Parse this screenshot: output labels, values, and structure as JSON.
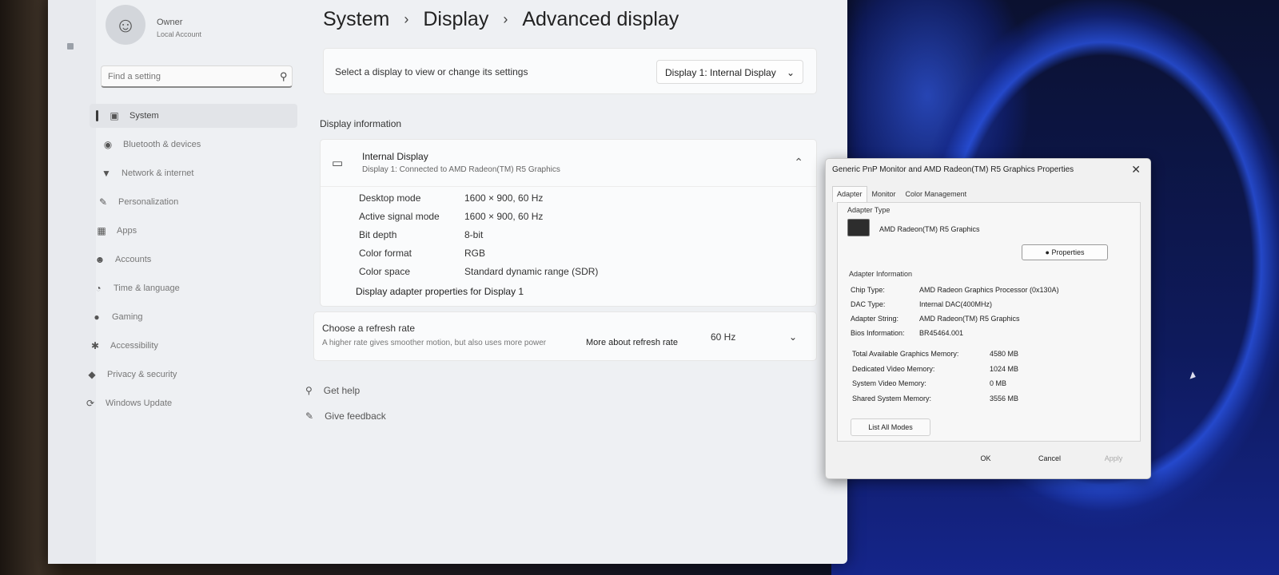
{
  "account": {
    "name": "Owner",
    "type": "Local Account"
  },
  "search": {
    "placeholder": "Find a setting"
  },
  "sidebar": {
    "items": [
      {
        "label": "System",
        "icon": "display-icon"
      },
      {
        "label": "Bluetooth & devices",
        "icon": "bluetooth-icon"
      },
      {
        "label": "Network & internet",
        "icon": "wifi-icon"
      },
      {
        "label": "Personalization",
        "icon": "brush-icon"
      },
      {
        "label": "Apps",
        "icon": "apps-icon"
      },
      {
        "label": "Accounts",
        "icon": "person-icon"
      },
      {
        "label": "Time & language",
        "icon": "globe-clock-icon"
      },
      {
        "label": "Gaming",
        "icon": "gamepad-icon"
      },
      {
        "label": "Accessibility",
        "icon": "accessibility-icon"
      },
      {
        "label": "Privacy & security",
        "icon": "shield-icon"
      },
      {
        "label": "Windows Update",
        "icon": "update-icon"
      }
    ]
  },
  "breadcrumb": {
    "part1": "System",
    "part2": "Display",
    "part3": "Advanced display"
  },
  "select_display": {
    "text": "Select a display to view or change its settings",
    "value": "Display 1: Internal Display"
  },
  "display_info": {
    "section_title": "Display information",
    "title": "Internal Display",
    "subtitle": "Display 1: Connected to AMD Radeon(TM) R5 Graphics",
    "rows": [
      {
        "key": "Desktop mode",
        "value": "1600 × 900, 60 Hz"
      },
      {
        "key": "Active signal mode",
        "value": "1600 × 900, 60 Hz"
      },
      {
        "key": "Bit depth",
        "value": "8-bit"
      },
      {
        "key": "Color format",
        "value": "RGB"
      },
      {
        "key": "Color space",
        "value": "Standard dynamic range (SDR)"
      }
    ],
    "adapter_link": "Display adapter properties for Display 1"
  },
  "refresh": {
    "title": "Choose a refresh rate",
    "subtitle": "A higher rate gives smoother motion, but also uses more power",
    "link": "More about refresh rate",
    "value": "60 Hz"
  },
  "help": {
    "get_help": "Get help",
    "feedback": "Give feedback"
  },
  "dialog": {
    "title": "Generic PnP Monitor and AMD Radeon(TM) R5 Graphics Properties",
    "tabs": [
      "Adapter",
      "Monitor",
      "Color Management"
    ],
    "adapter_type_label": "Adapter Type",
    "adapter_name": "AMD Radeon(TM) R5 Graphics",
    "properties_button": "Properties",
    "adapter_info_label": "Adapter Information",
    "info": [
      {
        "key": "Chip Type:",
        "value": "AMD Radeon Graphics Processor (0x130A)"
      },
      {
        "key": "DAC Type:",
        "value": "Internal DAC(400MHz)"
      },
      {
        "key": "Adapter String:",
        "value": "AMD Radeon(TM) R5 Graphics"
      },
      {
        "key": "Bios Information:",
        "value": "BR45464.001"
      }
    ],
    "memory": [
      {
        "key": "Total Available Graphics Memory:",
        "value": "4580 MB"
      },
      {
        "key": "Dedicated Video Memory:",
        "value": "1024 MB"
      },
      {
        "key": "System Video Memory:",
        "value": "0 MB"
      },
      {
        "key": "Shared System Memory:",
        "value": "3556 MB"
      }
    ],
    "list_modes": "List All Modes",
    "ok": "OK",
    "cancel": "Cancel",
    "apply": "Apply"
  }
}
